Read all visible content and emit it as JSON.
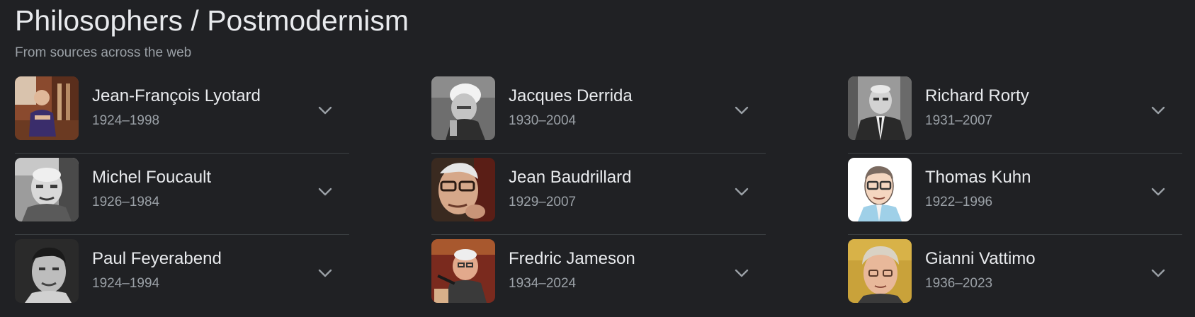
{
  "header": {
    "title": "Philosophers / Postmodernism",
    "subtitle": "From sources across the web"
  },
  "columns": [
    {
      "items": [
        {
          "name": "Jean-François Lyotard",
          "years": "1924–1998",
          "icon": "portrait-photo"
        },
        {
          "name": "Michel Foucault",
          "years": "1926–1984",
          "icon": "portrait-photo"
        },
        {
          "name": "Paul Feyerabend",
          "years": "1924–1994",
          "icon": "portrait-photo"
        }
      ]
    },
    {
      "items": [
        {
          "name": "Jacques Derrida",
          "years": "1930–2004",
          "icon": "portrait-photo"
        },
        {
          "name": "Jean Baudrillard",
          "years": "1929–2007",
          "icon": "portrait-photo"
        },
        {
          "name": "Fredric Jameson",
          "years": "1934–2024",
          "icon": "portrait-photo"
        }
      ]
    },
    {
      "items": [
        {
          "name": "Richard Rorty",
          "years": "1931–2007",
          "icon": "portrait-photo"
        },
        {
          "name": "Thomas Kuhn",
          "years": "1922–1996",
          "icon": "portrait-illustration"
        },
        {
          "name": "Gianni Vattimo",
          "years": "1936–2023",
          "icon": "portrait-photo"
        }
      ]
    }
  ],
  "colors": {
    "background": "#202124",
    "text_primary": "#e8eaed",
    "text_secondary": "#9aa0a6",
    "divider": "#3c4043"
  }
}
